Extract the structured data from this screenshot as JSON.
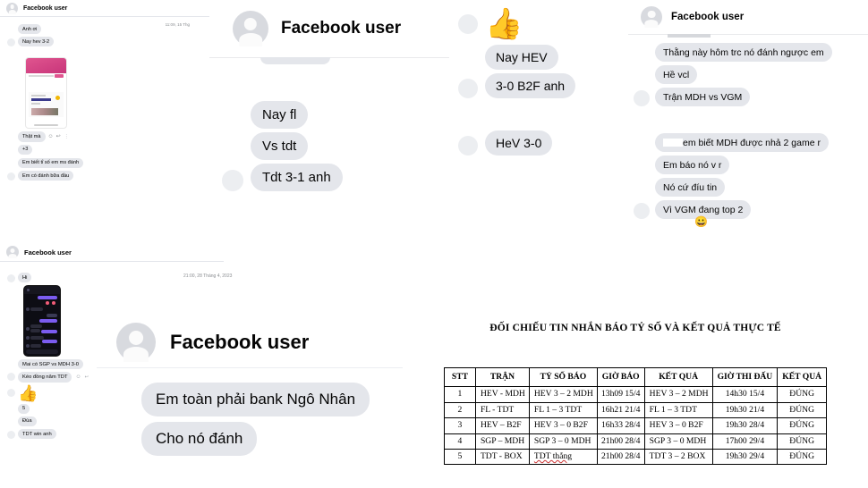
{
  "colors": {
    "thumb_blue": "#1b86f5",
    "bubble_gray": "#e4e6eb",
    "text": "#050505",
    "muted": "#8a8d91"
  },
  "panel1": {
    "header_name": "Facebook user",
    "timestamp": "11:09, 15 Thg",
    "messages": [
      "Anh ơi",
      "Nay hev 3-2"
    ],
    "attachment_caption": "Thật mà",
    "reaction": "+3",
    "messages2": [
      "Em biết tỉ số em ms đánh",
      "Em có đánh bữa đầu"
    ]
  },
  "panel2": {
    "header_name": "Facebook user",
    "messages": [
      "Nay fl",
      "Vs tdt",
      "Tdt 3-1 anh"
    ]
  },
  "panel3": {
    "reaction_icon": "thumbs-up",
    "messages": [
      "Nay HEV",
      "3-0 B2F anh"
    ],
    "messages2": [
      "HeV 3-0"
    ]
  },
  "panel4": {
    "header_name": "Facebook user",
    "group1": [
      "Thằng này hôm trc nó đánh ngược em",
      "Hề vcl",
      "Trận MDH vs VGM"
    ],
    "group2_prefix": "em biết MDH được nhả 2 game r",
    "group2": [
      "Em báo nó v    r",
      "Nó cứ đíu tin",
      "Vì VGM đang top 2"
    ],
    "emoji": "😀"
  },
  "panel5": {
    "header_name": "Facebook user",
    "timestamp": "21:00, 28 Tháng 4, 2023",
    "first": "Hi",
    "after_image": [
      "Mai có SGP vs MDH 3-0",
      "Kéo đồng năm TDT"
    ],
    "reaction_icon": "thumbs-up",
    "tail": [
      "5",
      "Đùa",
      "TDT win anh"
    ]
  },
  "panel6": {
    "header_name": "Facebook user",
    "messages": [
      "Em toàn phải bank Ngô Nhân",
      "Cho nó đánh"
    ]
  },
  "table": {
    "title": "ĐỐI CHIẾU TIN NHẮN BÁO TỶ SỐ VÀ KẾT QUẢ THỰC TẾ",
    "headers": [
      "STT",
      "TRẬN",
      "TỶ SỐ BÁO",
      "GIỜ BÁO",
      "KẾT QUẢ",
      "GIỜ THI ĐẤU",
      "KẾT QUẢ"
    ],
    "rows": [
      [
        "1",
        "HEV - MDH",
        "HEV 3 – 2 MDH",
        "13h09 15/4",
        "HEV 3 – 2 MDH",
        "14h30 15/4",
        "ĐÚNG"
      ],
      [
        "2",
        "FL - TDT",
        "FL 1 – 3 TDT",
        "16h21 21/4",
        "FL 1 – 3 TDT",
        "19h30 21/4",
        "ĐÚNG"
      ],
      [
        "3",
        "HEV – B2F",
        "HEV 3 – 0 B2F",
        "16h33 28/4",
        "HEV 3 – 0 B2F",
        "19h30 28/4",
        "ĐÚNG"
      ],
      [
        "4",
        "SGP – MDH",
        "SGP 3 – 0 MDH",
        "21h00 28/4",
        "SGP 3 – 0 MDH",
        "17h00 29/4",
        "ĐÚNG"
      ],
      [
        "5",
        "TDT - BOX",
        "TDT thắng",
        "21h00 28/4",
        "TDT 3 – 2 BOX",
        "19h30 29/4",
        "ĐÚNG"
      ]
    ]
  }
}
